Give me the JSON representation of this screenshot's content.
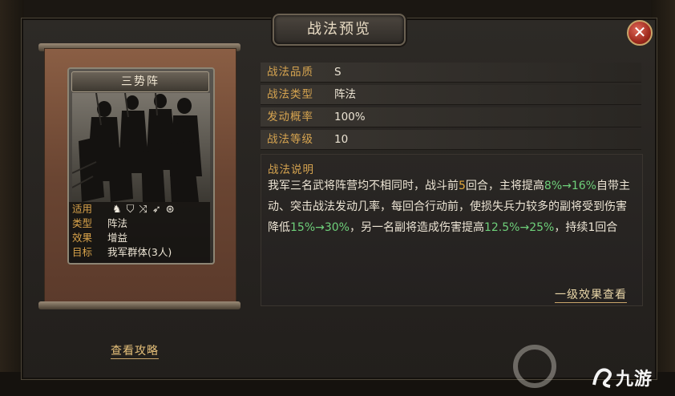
{
  "dialog": {
    "title": "战法预览",
    "close_icon": "close-icon",
    "close_glyph": "✕"
  },
  "card": {
    "name": "三势阵",
    "info": [
      {
        "label": "适用",
        "value": ""
      },
      {
        "label": "类型",
        "value": "阵法"
      },
      {
        "label": "效果",
        "value": "增益"
      },
      {
        "label": "目标",
        "value": "我军群体(3人)"
      }
    ],
    "troop_icons": [
      "cavalry-icon",
      "shield-icon",
      "bow-icon",
      "spear-icon",
      "chariot-icon"
    ],
    "troop_glyphs": [
      "♞",
      "⛉",
      "⤨",
      "➶",
      "⊛"
    ]
  },
  "stats": [
    {
      "label": "战法品质",
      "value": "S"
    },
    {
      "label": "战法类型",
      "value": "阵法"
    },
    {
      "label": "发动概率",
      "value": "100%"
    },
    {
      "label": "战法等级",
      "value": "10"
    }
  ],
  "description": {
    "title": "战法说明",
    "segments": [
      {
        "t": "我军三名武将阵营均不相同时，战斗前",
        "c": ""
      },
      {
        "t": "5",
        "c": "orange"
      },
      {
        "t": "回合，主将提高",
        "c": ""
      },
      {
        "t": "8%",
        "c": "green"
      },
      {
        "t": "→16%",
        "c": "green"
      },
      {
        "t": "自带主动、突击战法发动几率，每回合行动前，使损失兵力较多的副将受到伤害降低",
        "c": ""
      },
      {
        "t": "15%",
        "c": "green"
      },
      {
        "t": "→30%",
        "c": "green"
      },
      {
        "t": "，另一名副将造成伤害提高",
        "c": ""
      },
      {
        "t": "12.5%",
        "c": "green"
      },
      {
        "t": "→25%",
        "c": "green"
      },
      {
        "t": "，持续1回合",
        "c": ""
      }
    ]
  },
  "links": {
    "level_effect": "一级效果查看",
    "strategy": "查看攻略"
  },
  "watermark": {
    "text": "九游"
  },
  "colors": {
    "label_gold": "#d6a450",
    "highlight_green": "#6ed07a",
    "highlight_orange": "#e2a83c",
    "close_red": "#a02a1e"
  }
}
